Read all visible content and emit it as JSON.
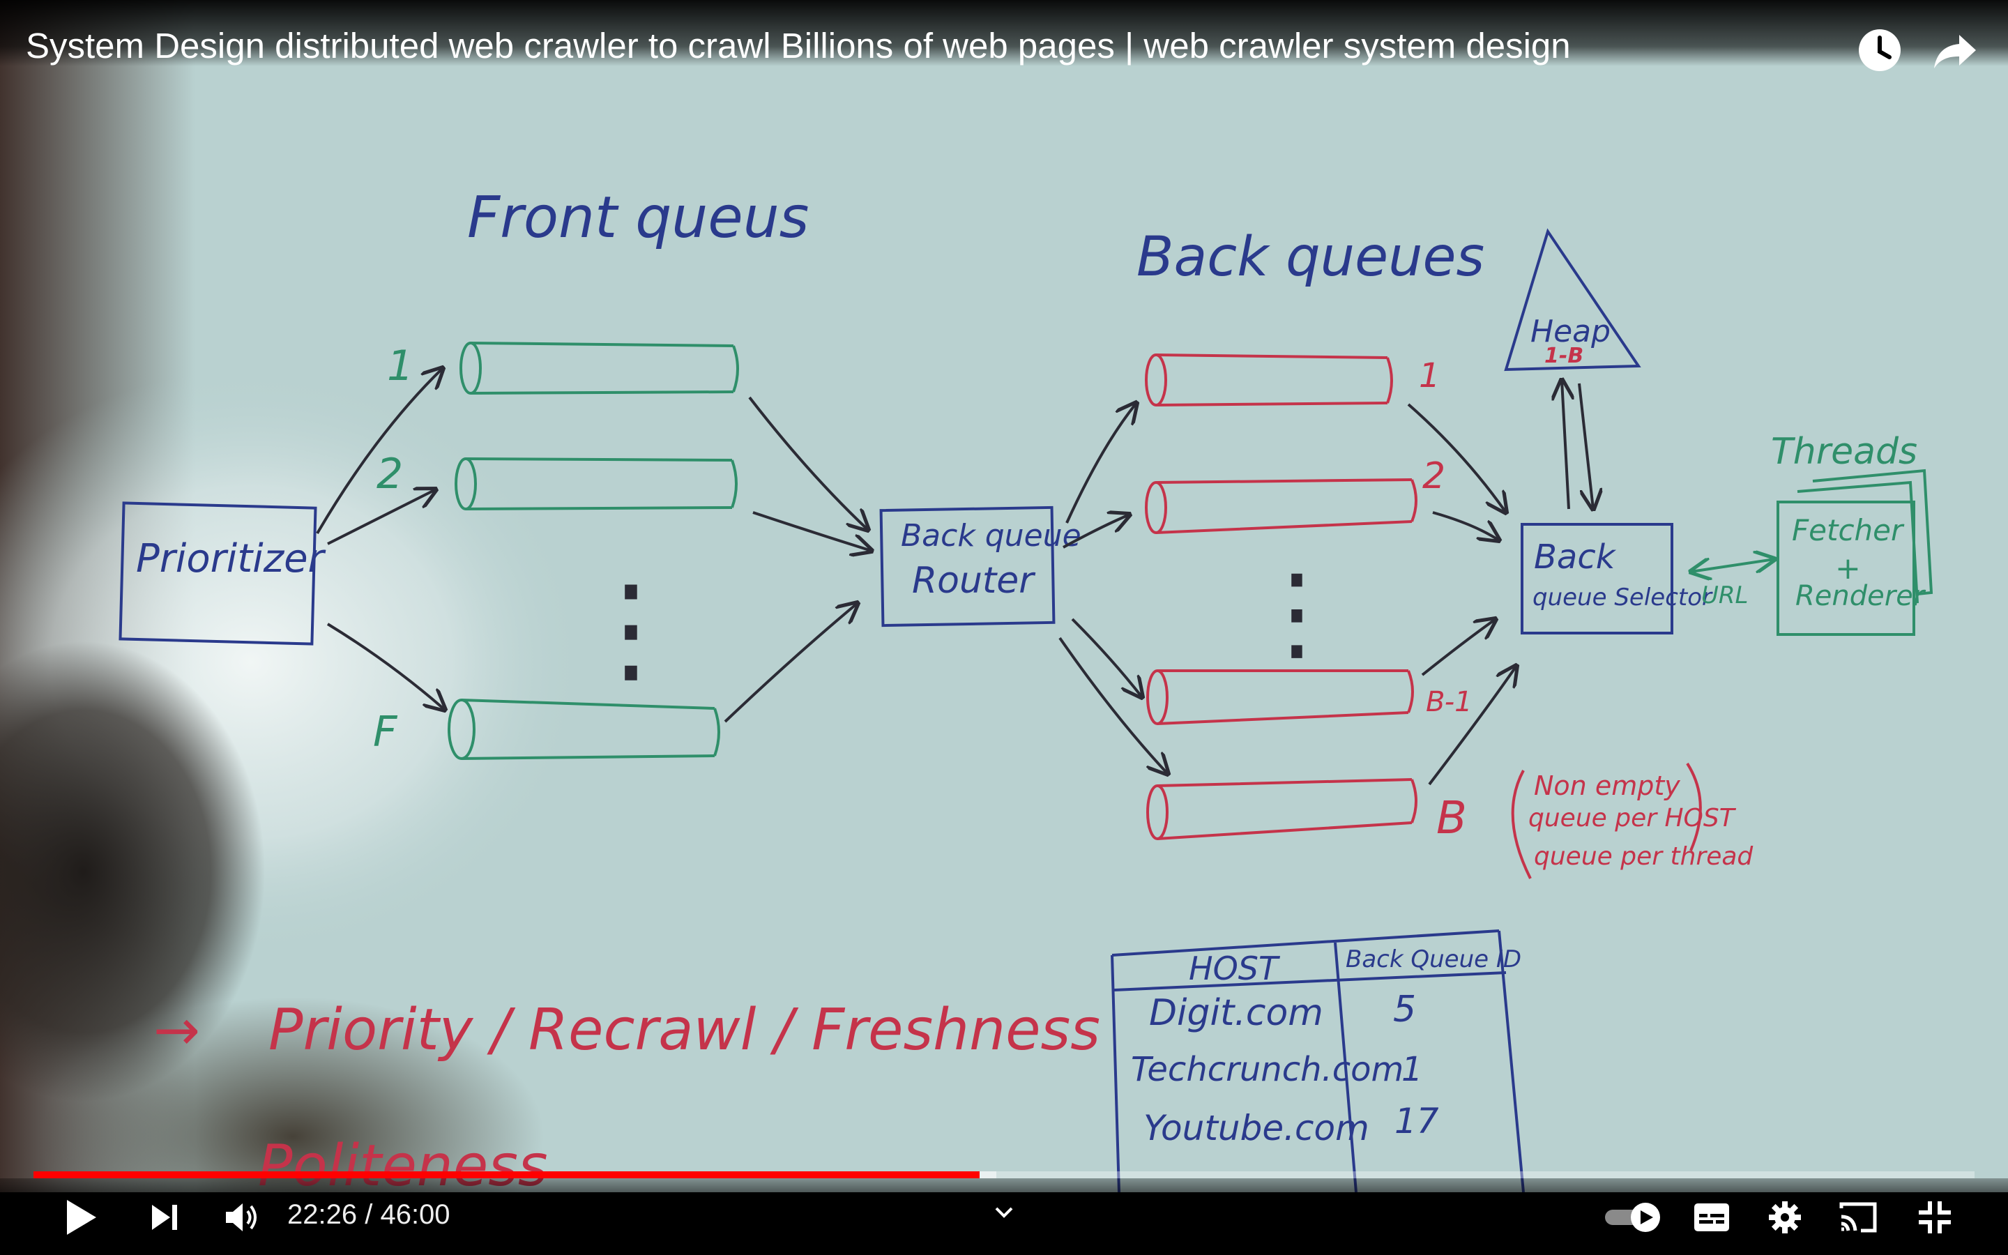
{
  "player": {
    "title": "System Design distributed web crawler to crawl Billions of web pages | web crawler system design",
    "current_time": "22:26",
    "time_separator": " / ",
    "duration": "46:00",
    "progress_fraction": 0.4875,
    "buffered_fraction": 0.496,
    "accent_color": "#ff0000"
  },
  "top_icons": [
    "watch-later-icon",
    "share-icon"
  ],
  "controls_left": [
    "play-icon",
    "next-icon",
    "volume-icon"
  ],
  "controls_right": [
    "autoplay-toggle-icon",
    "subtitles-icon",
    "settings-icon",
    "cast-icon",
    "exit-fullscreen-icon"
  ],
  "whiteboard": {
    "front_title": "Front queus",
    "back_title": "Back queues",
    "prioritizer": "Prioritizer",
    "router_line1": "Back queue",
    "router_line2": "Router",
    "front_labels": [
      "1",
      "2",
      "F"
    ],
    "front_dots": "⋮",
    "back_labels": [
      "1",
      "2",
      "B-1",
      "B"
    ],
    "back_dots": "⋮",
    "heap_label": "Heap",
    "heap_range": "1-B",
    "selector_line1": "Back",
    "selector_line2": "queue Selector",
    "url_label": "URL",
    "threads_label": "Threads",
    "fetcher_line1": "Fetcher",
    "fetcher_plus": "+",
    "fetcher_line2": "Renderer",
    "note": [
      "Non empty",
      "queue per HOST",
      "queue per thread"
    ],
    "table_headers": [
      "HOST",
      "Back Queue ID"
    ],
    "table_rows": [
      [
        "Digit.com",
        "5"
      ],
      [
        "Techcrunch.com",
        "1"
      ],
      [
        "Youtube.com",
        "17"
      ]
    ],
    "bottom_arrow": "→",
    "bottom_text": "Priority / Recrawl / Freshness",
    "bottom_text2": "Politeness",
    "colors": {
      "board": "#b9d1d0",
      "blue_ink": "#2a3a8c",
      "green_ink": "#2f8f6a",
      "red_ink": "#c5334a",
      "dark_ink": "#2b2b35"
    }
  }
}
